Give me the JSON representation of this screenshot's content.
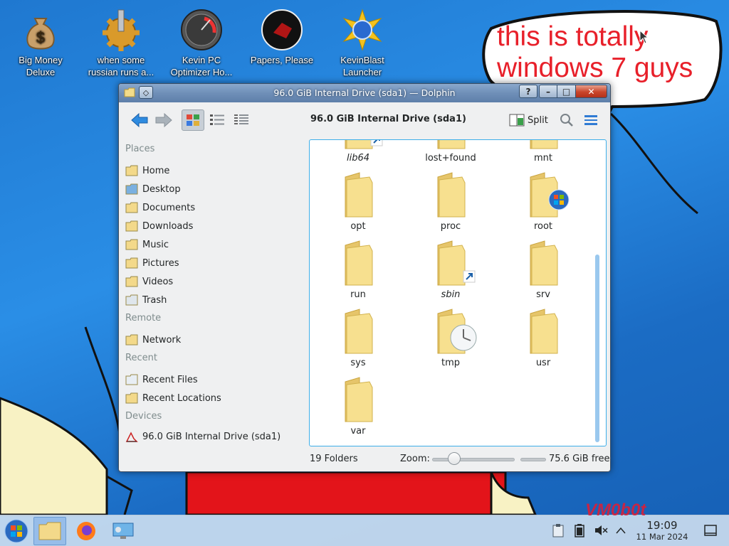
{
  "desktop": {
    "icons": [
      {
        "label": "Big Money\nDeluxe",
        "icon": "money-bag-icon"
      },
      {
        "label": "when some\nrussian runs a...",
        "icon": "gear-icon"
      },
      {
        "label": "Kevin PC\nOptimizer Ho...",
        "icon": "speedometer-icon"
      },
      {
        "label": "Papers, Please",
        "icon": "papers-please-icon"
      },
      {
        "label": "KevinBlast\nLauncher",
        "icon": "kevinblast-icon"
      }
    ],
    "bubble_text": "this is totally\nwindows 7 guys",
    "watermark": "VM0b0t"
  },
  "window": {
    "title": "96.0 GiB Internal Drive (sda1) — Dolphin",
    "buttons": {
      "help": "?",
      "minimize": "–",
      "maximize": "□",
      "close": "✕"
    }
  },
  "toolbar": {
    "location": "96.0 GiB Internal Drive (sda1)",
    "split_label": "Split"
  },
  "sidebar": {
    "places_header": "Places",
    "places": [
      {
        "label": "Home",
        "icon": "home-folder-icon"
      },
      {
        "label": "Desktop",
        "icon": "desktop-icon"
      },
      {
        "label": "Documents",
        "icon": "documents-icon"
      },
      {
        "label": "Downloads",
        "icon": "downloads-icon"
      },
      {
        "label": "Music",
        "icon": "music-icon"
      },
      {
        "label": "Pictures",
        "icon": "pictures-icon"
      },
      {
        "label": "Videos",
        "icon": "videos-icon"
      },
      {
        "label": "Trash",
        "icon": "trash-icon"
      }
    ],
    "remote_header": "Remote",
    "remote": [
      {
        "label": "Network",
        "icon": "network-icon"
      }
    ],
    "recent_header": "Recent",
    "recent": [
      {
        "label": "Recent Files",
        "icon": "recent-files-icon"
      },
      {
        "label": "Recent Locations",
        "icon": "recent-locations-icon"
      }
    ],
    "devices_header": "Devices",
    "devices": [
      {
        "label": "96.0 GiB Internal Drive (sda1)",
        "icon": "drive-icon",
        "usage_fraction": 0.21
      }
    ]
  },
  "files": [
    {
      "name": "lib64",
      "link": true
    },
    {
      "name": "lost+found",
      "link": false
    },
    {
      "name": "mnt",
      "link": false
    },
    {
      "name": "opt",
      "link": false
    },
    {
      "name": "proc",
      "link": false
    },
    {
      "name": "root",
      "link": false,
      "badge": "windows-logo"
    },
    {
      "name": "run",
      "link": false
    },
    {
      "name": "sbin",
      "link": true
    },
    {
      "name": "srv",
      "link": false
    },
    {
      "name": "sys",
      "link": false
    },
    {
      "name": "tmp",
      "link": false,
      "badge": "clock"
    },
    {
      "name": "usr",
      "link": false
    },
    {
      "name": "var",
      "link": false
    }
  ],
  "status": {
    "folder_count": "19 Folders",
    "zoom_label": "Zoom:",
    "free_space": "75.6 GiB free"
  },
  "taskbar": {
    "time": "19:09",
    "date": "11 Mar 2024"
  },
  "colors": {
    "accent": "#3daee9",
    "title_blue": "#6f8fb8",
    "bubble_red": "#e8202a"
  }
}
